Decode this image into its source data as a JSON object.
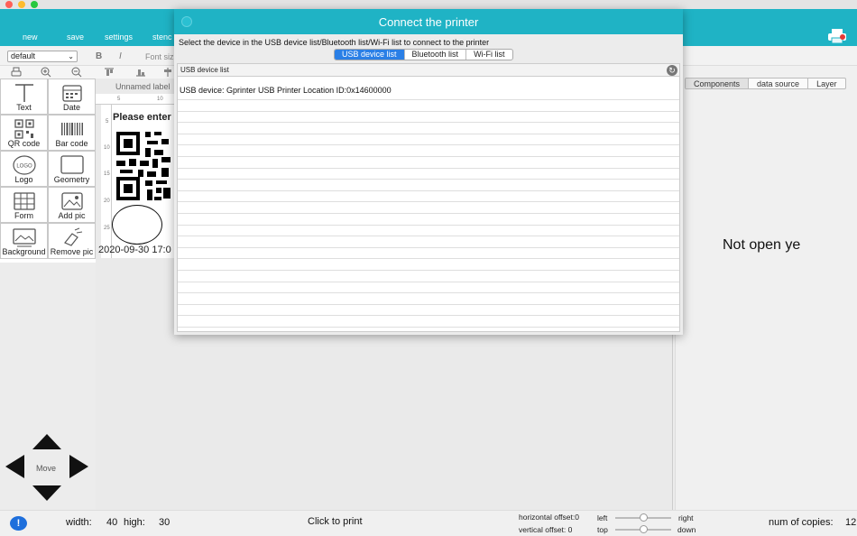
{
  "window": {
    "traffic_lights": {
      "close": "#ff5f57",
      "minimize": "#febc2e",
      "zoom": "#28c840"
    }
  },
  "toolbar": {
    "accent": "#1fb3c5",
    "new_label": "new",
    "save_label": "save",
    "settings_label": "settings",
    "stencil_label": "stenc",
    "printer_icon": "printer-icon"
  },
  "format": {
    "font_name": "default",
    "bold_label": "B",
    "italic_label": "I",
    "font_size_label": "Font siz"
  },
  "tools": [
    {
      "label": "Text",
      "icon": "text-icon"
    },
    {
      "label": "Date",
      "icon": "calendar-icon"
    },
    {
      "label": "QR code",
      "icon": "qr-code-icon"
    },
    {
      "label": "Bar code",
      "icon": "barcode-icon"
    },
    {
      "label": "Logo",
      "icon": "logo-icon"
    },
    {
      "label": "Geometry",
      "icon": "geometry-icon"
    },
    {
      "label": "Form",
      "icon": "table-icon"
    },
    {
      "label": "Add pic",
      "icon": "image-icon"
    },
    {
      "label": "Background",
      "icon": "background-icon"
    },
    {
      "label": "Remove pic",
      "icon": "eraser-icon"
    }
  ],
  "canvas": {
    "label_name": "Unnamed label",
    "ruler_h": [
      "5",
      "10"
    ],
    "ruler_v": [
      "5",
      "10",
      "15",
      "20",
      "25"
    ],
    "please_text": "Please enter",
    "date_text": "2020-09-30 17:0"
  },
  "move": {
    "label": "Move"
  },
  "right_panel": {
    "tabs": [
      "Components",
      "data source",
      "Layer"
    ],
    "not_open_text": "Not open ye"
  },
  "dialog": {
    "title": "Connect the printer",
    "instruction": "Select the device in the USB device list/Bluetooth list/Wi-Fi list to connect to the printer",
    "tabs": [
      "USB device list",
      "Bluetooth list",
      "Wi-Fi list"
    ],
    "active_tab": "USB device list",
    "list_header": "USB device list",
    "device_text": "USB device:  Gprinter USB Printer Location ID:0x14600000",
    "accent_selected": "#2a7fe6"
  },
  "status": {
    "width_label": "width:",
    "width_value": "40",
    "high_label": "high:",
    "high_value": "30",
    "print_label": "Click to print",
    "h_offset_label": "horizontal offset:0",
    "v_offset_label": "vertical offset: 0",
    "left_label": "left",
    "right_label": "right",
    "top_label": "top",
    "down_label": "down",
    "copies_label": "num of copies:",
    "copies_value": "12"
  }
}
